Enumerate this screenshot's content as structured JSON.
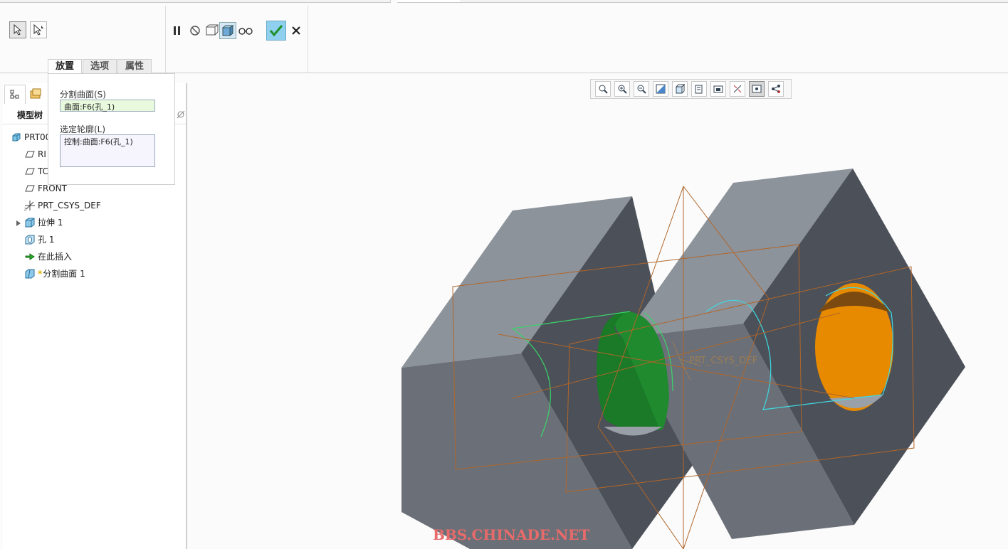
{
  "dashboard": {
    "tabs": [
      {
        "label": "放置"
      },
      {
        "label": "选项"
      },
      {
        "label": "属性"
      }
    ]
  },
  "placement_panel": {
    "split_surface_label": "分割曲面(S)",
    "split_surface_value": "曲面:F6(孔_1)",
    "silhouette_label": "选定轮廓(L)",
    "silhouette_value": "控制:曲面:F6(孔_1)"
  },
  "model_tree": {
    "header": "模型树",
    "items": [
      {
        "label": "PRT00",
        "icon": "part-icon"
      },
      {
        "label": "RI",
        "icon": "datum-plane-icon"
      },
      {
        "label": "TC",
        "icon": "datum-plane-icon"
      },
      {
        "label": "FRONT",
        "icon": "datum-plane-icon"
      },
      {
        "label": "PRT_CSYS_DEF",
        "icon": "csys-icon"
      },
      {
        "label": "拉伸 1",
        "icon": "extrude-icon"
      },
      {
        "label": "孔 1",
        "icon": "hole-icon"
      },
      {
        "label": "在此插入",
        "icon": "insert-here-icon"
      },
      {
        "label": "分割曲面 1",
        "icon": "split-surface-icon"
      }
    ]
  },
  "viewport": {
    "csys_label": "PRT_CSYS_DEF"
  },
  "watermark": "BBS.CHINADE.NET",
  "colors": {
    "green_surface": "#1f8a2e",
    "orange_surface": "#e88a00",
    "datum_plane": "#b0662a",
    "cyan_curve": "#3fd9e0",
    "block_top": "#8d939b",
    "block_front": "#6b7078",
    "block_side": "#4c5058"
  }
}
